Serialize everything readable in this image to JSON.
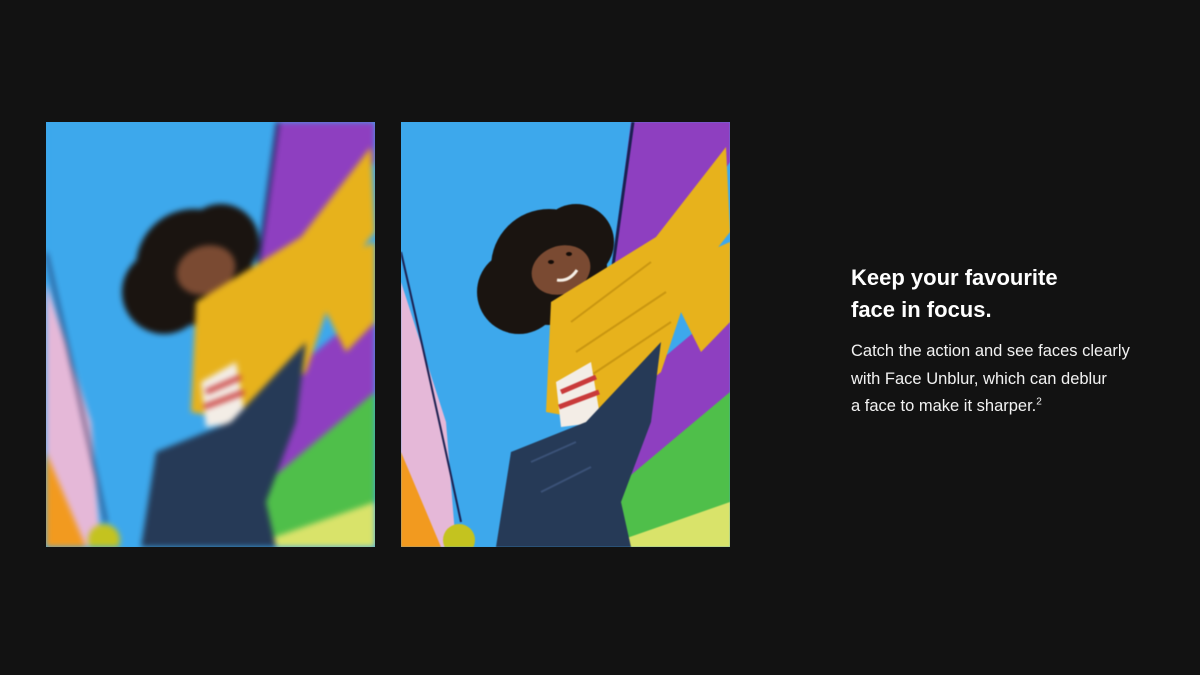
{
  "feature": {
    "headline_line1": "Keep your favourite",
    "headline_line2": "face in focus.",
    "body_line1": "Catch the action and see faces clearly",
    "body_line2": "with Face Unblur, which can deblur",
    "body_line3": "a face to make it sharper.",
    "footnote_marker": "2"
  },
  "photos": {
    "before_state": "blurred",
    "after_state": "unblurred"
  },
  "colors": {
    "background": "#121212",
    "heading": "#ffffff",
    "body_text": "#f2f2f2",
    "parachute_blue": "#3da8ec",
    "parachute_purple": "#8e3fc0",
    "parachute_green": "#4fbf4a",
    "parachute_pink": "#e5b8d8",
    "parachute_orange": "#f29a1f",
    "sweater_yellow": "#e7b21c",
    "jeans_blue": "#263a57"
  }
}
